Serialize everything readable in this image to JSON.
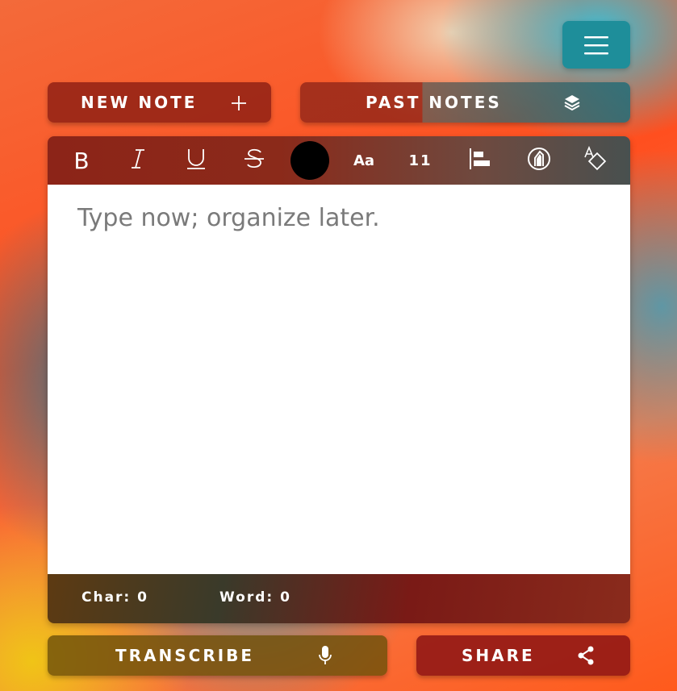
{
  "menu": {
    "icon": "hamburger-menu-icon"
  },
  "actions": {
    "new_note_label": "NEW NOTE",
    "new_note_icon": "plus-icon",
    "past_notes_label": "PAST NOTES",
    "past_notes_icon": "layers-icon"
  },
  "toolbar": {
    "bold_glyph": "B",
    "italic_glyph": "I",
    "underline_glyph": "U",
    "strikethrough_glyph": "S",
    "text_color": "#000000",
    "font_label": "Aa",
    "font_size": "11",
    "align_icon": "align-left-icon",
    "highlight_icon": "highlighter-icon",
    "clear_format_icon": "eraser-shapes-icon"
  },
  "editor": {
    "placeholder": "Type now; organize later.",
    "value": ""
  },
  "status": {
    "char_label": "Char: 0",
    "word_label": "Word: 0"
  },
  "footer": {
    "transcribe_label": "TRANSCRIBE",
    "transcribe_icon": "microphone-icon",
    "share_label": "SHARE",
    "share_icon": "share-icon"
  },
  "colors": {
    "menu_button": "#1e8e9a",
    "editor_background": "#ffffff",
    "placeholder_text": "#7a7a7a"
  }
}
